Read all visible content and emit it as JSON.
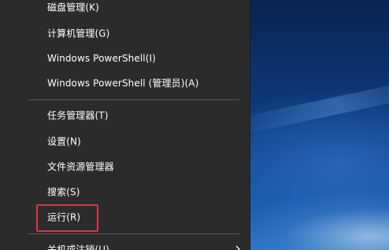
{
  "context_menu": {
    "items_group1": [
      {
        "label": "磁盘管理(K)"
      },
      {
        "label": "计算机管理(G)"
      },
      {
        "label": "Windows PowerShell(I)"
      },
      {
        "label": "Windows PowerShell (管理员)(A)"
      }
    ],
    "items_group2": [
      {
        "label": "任务管理器(T)"
      },
      {
        "label": "设置(N)"
      },
      {
        "label": "文件资源管理器"
      },
      {
        "label": "搜索(S)"
      },
      {
        "label": "运行(R)"
      }
    ],
    "items_group3": [
      {
        "label": "关机或注销(U)",
        "has_submenu": true
      }
    ]
  },
  "colors": {
    "menu_background": "#2b2b2b",
    "menu_text": "#ffffff",
    "highlight_border": "#d9363e",
    "desktop_accent": "#1258a8"
  }
}
